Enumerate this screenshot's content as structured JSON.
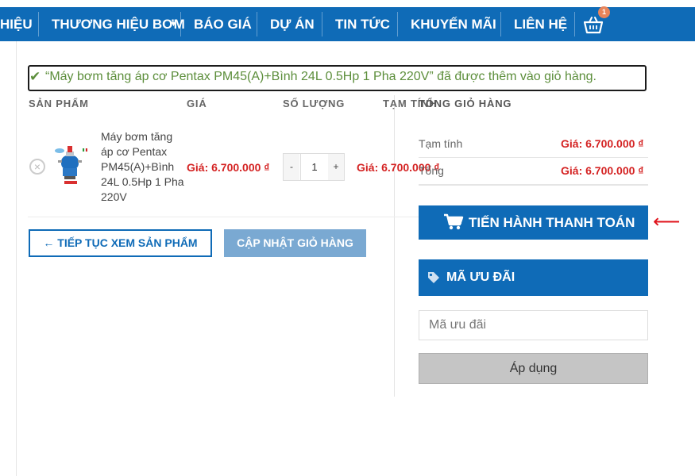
{
  "nav": {
    "items": [
      "HIỆU",
      "THƯƠNG HIỆU BƠM",
      "BÁO GIÁ",
      "DỰ ÁN",
      "TIN TỨC",
      "KHUYẾN MÃI",
      "LIÊN HỆ"
    ],
    "cart_count": "1"
  },
  "notice": {
    "text": "“Máy bơm tăng áp cơ Pentax PM45(A)+Bình 24L 0.5Hp 1 Pha 220V” đã được thêm vào giỏ hàng."
  },
  "cart": {
    "headers": {
      "product": "SẢN PHẨM",
      "price": "GIÁ",
      "quantity": "SỐ LƯỢNG",
      "subtotal": "TẠM TÍNH"
    },
    "items": [
      {
        "name": "Máy bơm tăng áp cơ Pentax PM45(A)+Bình 24L 0.5Hp 1 Pha 220V",
        "price": "Giá: 6.700.000 ₫",
        "quantity": "1",
        "subtotal": "Giá: 6.700.000 ₫"
      }
    ],
    "qty_minus": "-",
    "qty_plus": "+",
    "continue_button": "← TIẾP TỤC XEM SẢN PHẨM",
    "update_button": "CẬP NHẬT GIỎ HÀNG"
  },
  "totals": {
    "header": "TỔNG GIỎ HÀNG",
    "subtotal_label": "Tạm tính",
    "subtotal_value": "Giá: 6.700.000 ₫",
    "total_label": "Tổng",
    "total_value": "Giá: 6.700.000 ₫",
    "checkout_button": "TIẾN HÀNH THANH TOÁN"
  },
  "coupon": {
    "header": "MÃ ƯU ĐÃI",
    "placeholder": "Mã ưu đãi",
    "apply_button": "Áp dụng"
  },
  "colors": {
    "brand_blue": "#0f6bb7",
    "price_red": "#d42222",
    "success_green": "#5c8e3b",
    "annotation_arrow": "#e0131b"
  },
  "icons": [
    "shopping-basket-icon",
    "checkmark-icon",
    "remove-icon",
    "shopping-cart-icon",
    "tag-icon",
    "left-arrow-icon"
  ]
}
